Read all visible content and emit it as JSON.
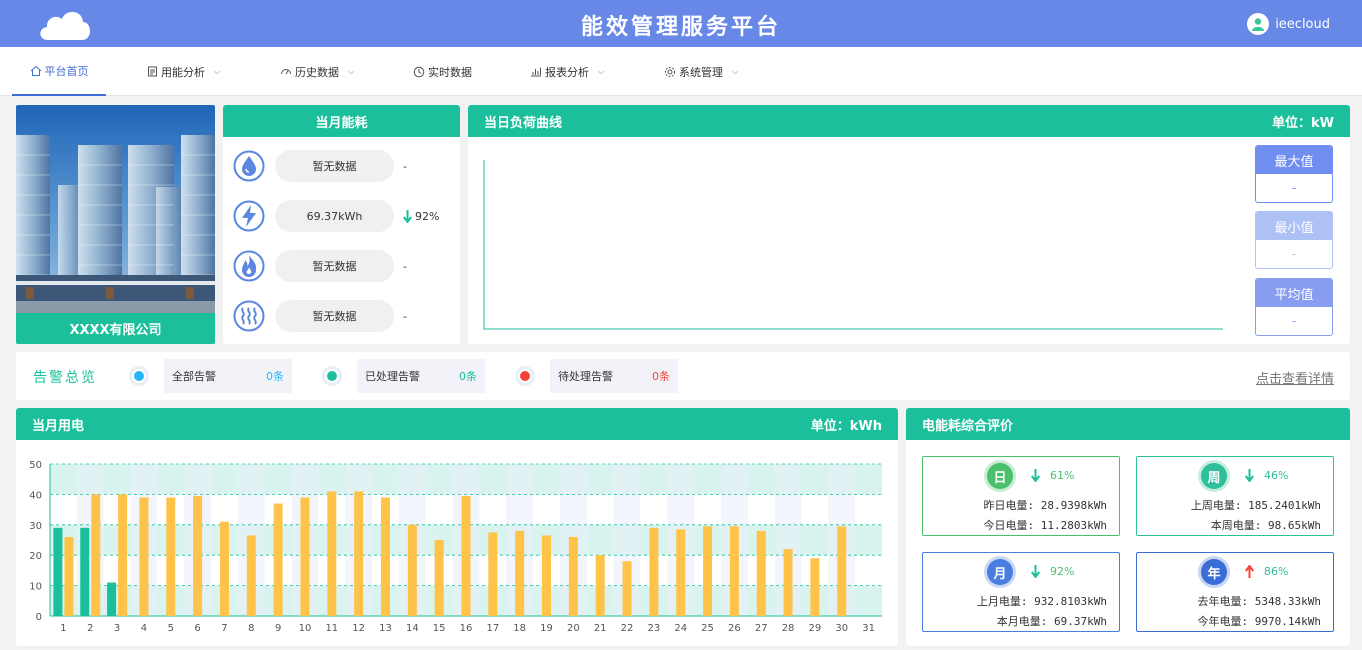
{
  "header": {
    "title": "能效管理服务平台",
    "username": "ieecloud"
  },
  "nav": [
    {
      "label": "平台首页",
      "icon": "home-icon",
      "dropdown": false
    },
    {
      "label": "用能分析",
      "icon": "doc-icon",
      "dropdown": true
    },
    {
      "label": "历史数据",
      "icon": "gauge-icon",
      "dropdown": true
    },
    {
      "label": "实时数据",
      "icon": "clock-icon",
      "dropdown": false
    },
    {
      "label": "报表分析",
      "icon": "bar-chart-icon",
      "dropdown": true
    },
    {
      "label": "系统管理",
      "icon": "gear-icon",
      "dropdown": true
    }
  ],
  "company": {
    "name": "XXXX有限公司"
  },
  "monthly_energy": {
    "title": "当月能耗",
    "rows": [
      {
        "icon": "water-icon",
        "value": "暂无数据",
        "trend": "-"
      },
      {
        "icon": "electricity-icon",
        "value": "69.37kWh",
        "trend": "92%",
        "direction": "down"
      },
      {
        "icon": "gas-icon",
        "value": "暂无数据",
        "trend": "-"
      },
      {
        "icon": "heat-icon",
        "value": "暂无数据",
        "trend": "-"
      }
    ]
  },
  "load_curve": {
    "title": "当日负荷曲线",
    "unit": "单位：kW",
    "stats": [
      {
        "label": "最大值",
        "value": "-"
      },
      {
        "label": "最小值",
        "value": "-"
      },
      {
        "label": "平均值",
        "value": "-"
      }
    ]
  },
  "alarms": {
    "title": "告警总览",
    "items": [
      {
        "label": "全部告警",
        "count": "0条",
        "color": "#29b6f6"
      },
      {
        "label": "已处理告警",
        "count": "0条",
        "color": "#1bbf9b"
      },
      {
        "label": "待处理告警",
        "count": "0条",
        "color": "#f44336"
      }
    ],
    "detail_link": "点击查看详情"
  },
  "monthly_power": {
    "title": "当月用电",
    "unit": "单位：kWh"
  },
  "chart_data": {
    "type": "bar",
    "categories": [
      "1",
      "2",
      "3",
      "4",
      "5",
      "6",
      "7",
      "8",
      "9",
      "10",
      "11",
      "12",
      "13",
      "14",
      "15",
      "16",
      "17",
      "18",
      "19",
      "20",
      "21",
      "22",
      "23",
      "24",
      "25",
      "26",
      "27",
      "28",
      "29",
      "30",
      "31"
    ],
    "series": [
      {
        "values": [
          29,
          29,
          11,
          null,
          null,
          null,
          null,
          null,
          null,
          null,
          null,
          null,
          null,
          null,
          null,
          null,
          null,
          null,
          null,
          null,
          null,
          null,
          null,
          null,
          null,
          null,
          null,
          null,
          null,
          null,
          null
        ],
        "color": "#1bbf9b"
      },
      {
        "values": [
          26,
          40,
          40,
          39,
          39,
          39.5,
          31,
          26.5,
          37,
          39,
          41,
          41,
          39,
          30,
          25,
          39.5,
          27.5,
          28,
          26.5,
          26,
          20,
          18,
          29,
          28.5,
          29.5,
          29.5,
          28,
          22,
          19,
          29.5,
          null
        ],
        "color": "#ffc34a"
      }
    ],
    "ylim": [
      0,
      50
    ],
    "yticks": [
      0,
      10,
      20,
      30,
      40,
      50
    ],
    "grid": true
  },
  "evaluation": {
    "title": "电能耗综合评价",
    "cards": [
      {
        "badge": "日",
        "direction": "down",
        "pct": "61%",
        "line1_label": "昨日电量:",
        "line1_value": "28.9398kWh",
        "line2_label": "今日电量:",
        "line2_value": "11.2803kWh",
        "color": "#4cbf6a"
      },
      {
        "badge": "周",
        "direction": "down",
        "pct": "46%",
        "line1_label": "上周电量:",
        "line1_value": "185.2401kWh",
        "line2_label": "本周电量:",
        "line2_value": "98.65kWh",
        "color": "#2fbf9a"
      },
      {
        "badge": "月",
        "direction": "down",
        "pct": "92%",
        "line1_label": "上月电量:",
        "line1_value": "932.8103kWh",
        "line2_label": "本月电量:",
        "line2_value": "69.37kWh",
        "color": "#4a7de0"
      },
      {
        "badge": "年",
        "direction": "up",
        "pct": "86%",
        "line1_label": "去年电量:",
        "line1_value": "5348.33kWh",
        "line2_label": "今年电量:",
        "line2_value": "9970.14kWh",
        "color": "#3a6ed6"
      }
    ]
  }
}
